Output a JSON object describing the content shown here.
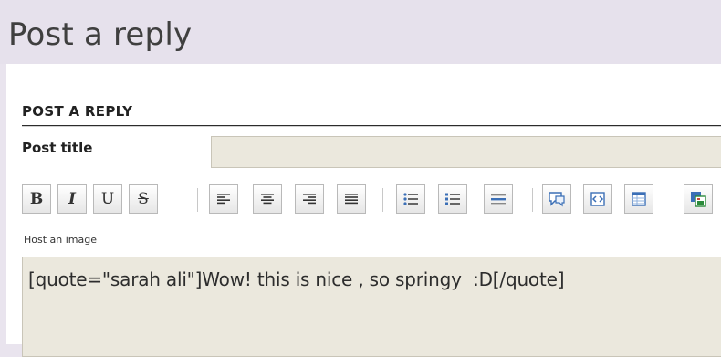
{
  "page": {
    "title": "Post a reply"
  },
  "form": {
    "section_title": "POST A REPLY",
    "post_title_label": "Post title",
    "post_title_value": "",
    "host_image_link": "Host an image",
    "message_value": "[quote=\"sarah ali\"]Wow! this is nice , so springy  :D[/quote]"
  },
  "toolbar": {
    "bold_label": "B",
    "italic_label": "I",
    "underline_label": "U",
    "strike_label": "S",
    "icons": [
      "bold-icon",
      "italic-icon",
      "underline-icon",
      "strikethrough-icon",
      "align-left-icon",
      "align-center-icon",
      "align-right-icon",
      "align-justify-icon",
      "bulleted-list-icon",
      "numbered-list-icon",
      "horizontal-rule-icon",
      "quote-icon",
      "code-icon",
      "table-icon",
      "image-icon"
    ]
  },
  "colors": {
    "header_bg": "#e6e1ec",
    "input_bg": "#ebe8dd",
    "accent_blue": "#3b6fb6"
  }
}
